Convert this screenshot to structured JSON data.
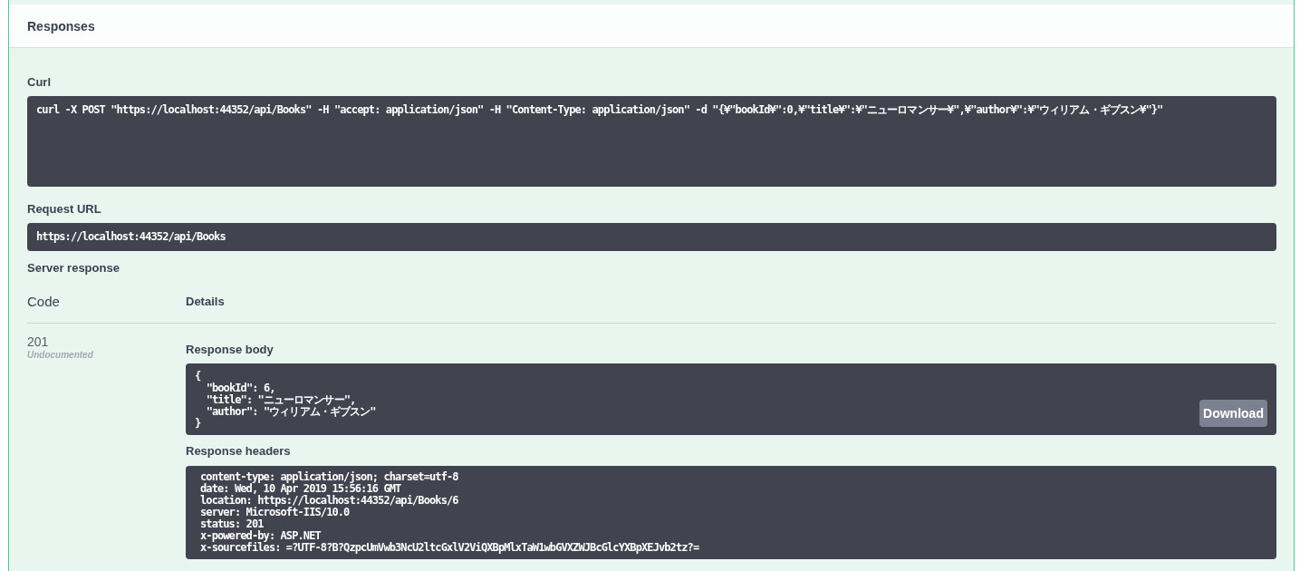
{
  "section": {
    "title": "Responses"
  },
  "curl": {
    "label": "Curl",
    "command": "curl -X POST \"https://localhost:44352/api/Books\" -H \"accept: application/json\" -H \"Content-Type: application/json\" -d \"{¥\"bookId¥\":0,¥\"title¥\":¥\"ニューロマンサー¥\",¥\"author¥\":¥\"ウィリアム・ギブスン¥\"}\""
  },
  "request_url": {
    "label": "Request URL",
    "value": "https://localhost:44352/api/Books"
  },
  "server_response": {
    "label": "Server response",
    "columns": [
      "Code",
      "Details"
    ],
    "code": "201",
    "code_note": "Undocumented",
    "body": {
      "label": "Response body",
      "lines": [
        "{",
        "  \"bookId\": 6,",
        "  \"title\": \"ニューロマンサー\",",
        "  \"author\": \"ウィリアム・ギブスン\"",
        "}"
      ],
      "download": "Download"
    },
    "headers": {
      "label": "Response headers",
      "lines": [
        "content-type: application/json; charset=utf-8",
        "date: Wed, 10 Apr 2019 15:56:16 GMT",
        "location: https://localhost:44352/api/Books/6",
        "server: Microsoft-IIS/10.0",
        "status: 201",
        "x-powered-by: ASP.NET",
        "x-sourcefiles: =?UTF-8?B?QzpcUmVwb3NcU2ltcGxlV2ViQXBpMlxTaW1wbGVXZWJBcGlcYXBpXEJvb2tz?="
      ]
    }
  }
}
